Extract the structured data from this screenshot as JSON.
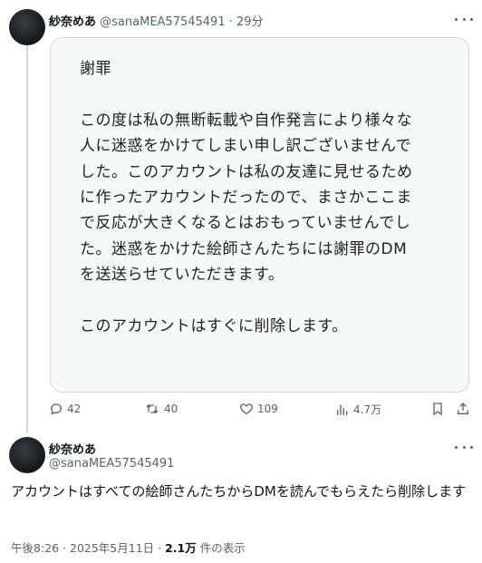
{
  "tweet1": {
    "display_name": "紗奈めあ",
    "handle": "@sanaMEA57545491",
    "separator": "·",
    "time": "29分",
    "image_text": {
      "title": "謝罪",
      "para1_lines": [
        "この度は私の無断転載や自作発言により様々な",
        "人に迷惑をかけてしまい申し訳ございませんで",
        "した。このアカウントは私の友達に見せるため",
        "に作ったアカウントだったので、まさかここま",
        "で反応が大きくなるとはおもっていませんでし",
        "た。迷惑をかけた絵師さんたちには謝罪のDM",
        "を送送らせていただきます。"
      ],
      "para2": "このアカウントはすぐに削除します。"
    },
    "actions": {
      "replies": "42",
      "retweets": "40",
      "likes": "109",
      "views": "4.7万"
    }
  },
  "tweet2": {
    "display_name": "紗奈めあ",
    "handle": "@sanaMEA57545491",
    "body": "アカウントはすべての絵師さんたちからDMを読んでもらえたら削除します",
    "timestamp_prefix": "午後8:26 · 2025年5月11日 · ",
    "view_count": "2.1万",
    "view_suffix": " 件の表示"
  },
  "icons": {
    "reply": "reply-icon",
    "retweet": "retweet-icon",
    "like": "heart-icon",
    "views": "views-icon",
    "bookmark": "bookmark-icon",
    "share": "share-icon",
    "more": "more-icon"
  },
  "colors": {
    "secondary_text": "#536471",
    "primary_text": "#0f1419",
    "border": "#cfd9de"
  }
}
